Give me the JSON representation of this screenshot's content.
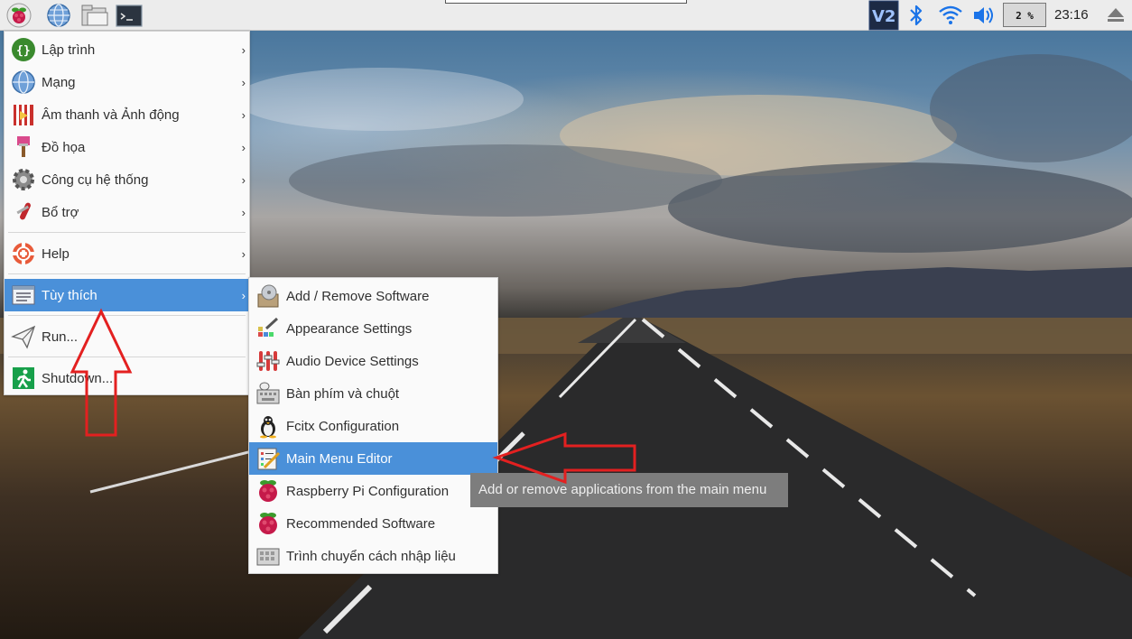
{
  "panel": {
    "clock": "23:16",
    "cpu_usage": "2 %",
    "launchers": [
      "raspberry-menu-icon",
      "web-browser-icon",
      "file-manager-icon",
      "terminal-icon"
    ],
    "tray": [
      "vnc-icon",
      "bluetooth-icon",
      "wifi-icon",
      "volume-icon",
      "eject-icon"
    ]
  },
  "main_menu": {
    "items": [
      {
        "label": "Lập trình",
        "icon": "programming-icon",
        "submenu": true
      },
      {
        "label": "Mạng",
        "icon": "internet-icon",
        "submenu": true
      },
      {
        "label": "Âm thanh và Ảnh động",
        "icon": "sound-video-icon",
        "submenu": true
      },
      {
        "label": "Đồ họa",
        "icon": "graphics-icon",
        "submenu": true
      },
      {
        "label": "Công cụ hệ thống",
        "icon": "system-tools-icon",
        "submenu": true
      },
      {
        "label": "Bổ trợ",
        "icon": "accessories-icon",
        "submenu": true
      },
      {
        "label": "Help",
        "icon": "help-icon",
        "submenu": true
      },
      {
        "label": "Tùy thích",
        "icon": "preferences-icon",
        "submenu": true,
        "active": true
      },
      {
        "label": "Run...",
        "icon": "run-icon",
        "submenu": false
      },
      {
        "label": "Shutdown...",
        "icon": "shutdown-icon",
        "submenu": false
      }
    ]
  },
  "preferences_submenu": {
    "items": [
      {
        "label": "Add / Remove Software",
        "icon": "add-remove-software-icon"
      },
      {
        "label": "Appearance Settings",
        "icon": "appearance-settings-icon"
      },
      {
        "label": "Audio Device Settings",
        "icon": "audio-device-settings-icon"
      },
      {
        "label": "Bàn phím và chuột",
        "icon": "keyboard-mouse-icon"
      },
      {
        "label": "Fcitx Configuration",
        "icon": "fcitx-penguin-icon"
      },
      {
        "label": "Main Menu Editor",
        "icon": "main-menu-editor-icon",
        "active": true
      },
      {
        "label": "Raspberry Pi Configuration",
        "icon": "raspberry-pi-config-icon"
      },
      {
        "label": "Recommended Software",
        "icon": "recommended-software-icon"
      },
      {
        "label": "Trình chuyển cách nhập liệu",
        "icon": "input-method-switcher-icon"
      }
    ]
  },
  "tooltip": {
    "text": "Add or remove applications from the main menu"
  },
  "annotations": {
    "arrow_color": "#e32020",
    "highlight_color": "#4a90d9"
  }
}
